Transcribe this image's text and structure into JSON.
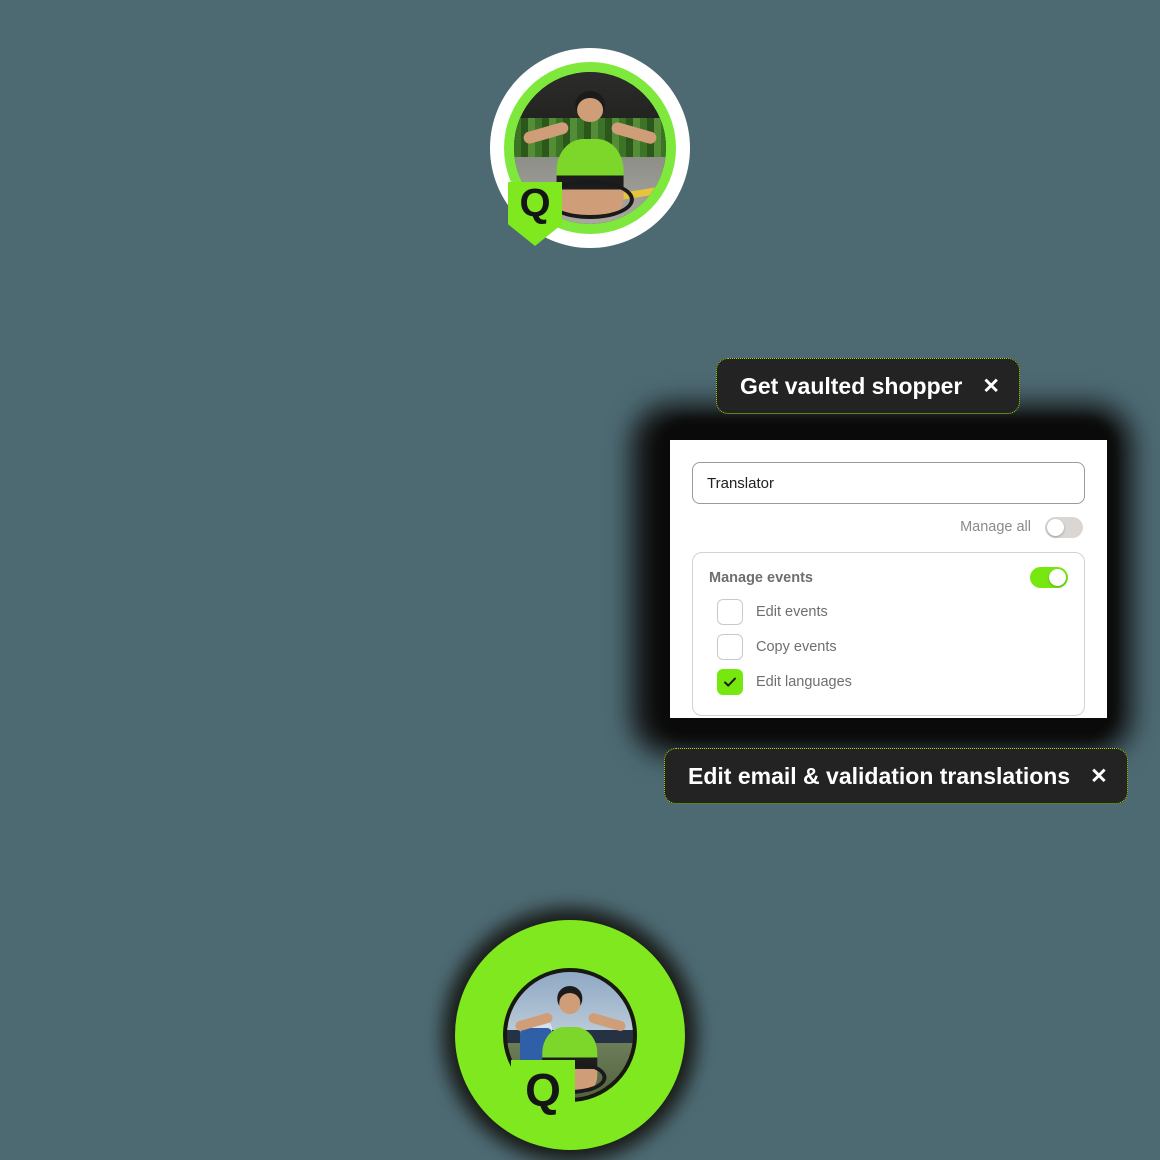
{
  "page": {
    "background_color": "#4d6a73"
  },
  "avatars": {
    "top": {
      "name": "profile-avatar-top",
      "badge_letter": "Q",
      "ring_color": "#7fe83c",
      "outer_ring_color": "#ffffff",
      "alt": "Cyclist crossing finish line with arms outstretched"
    },
    "bottom": {
      "name": "profile-avatar-bottom",
      "badge_letter": "Q",
      "ring_color": "#7fe81f",
      "alt": "Cyclist on a bike drinking from a bottle"
    }
  },
  "tooltips": {
    "top": {
      "label": "Get vaulted shopper",
      "close_glyph": "✕"
    },
    "bottom": {
      "label": "Edit email & validation translations",
      "close_glyph": "✕"
    }
  },
  "card": {
    "search": {
      "value": "Translator",
      "placeholder": "Translator"
    },
    "manage_all": {
      "label": "Manage all",
      "state": "off"
    },
    "panel": {
      "title": "Manage events",
      "toggle_state": "on",
      "toggle_color": "#77e80f",
      "items": [
        {
          "label": "Edit events",
          "checked": false
        },
        {
          "label": "Copy events",
          "checked": false
        },
        {
          "label": "Edit languages",
          "checked": true
        }
      ]
    }
  }
}
